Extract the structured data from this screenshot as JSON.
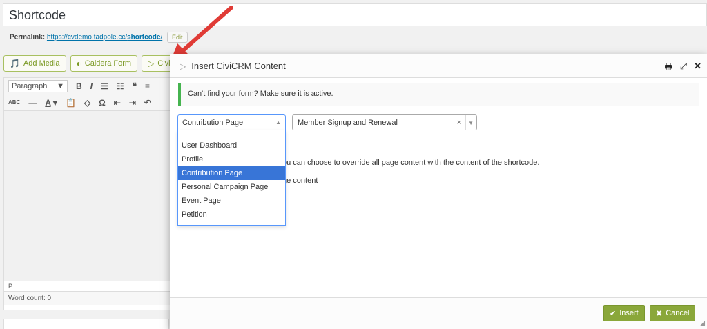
{
  "post": {
    "title": "Shortcode",
    "permalink_label": "Permalink:",
    "permalink_base": "https://cvdemo.tadpole.cc/",
    "permalink_slug": "shortcode",
    "permalink_end": "/",
    "edit_label": "Edit"
  },
  "media_buttons": [
    {
      "label": "Add Media",
      "icon": "add-media-icon"
    },
    {
      "label": "Caldera Form",
      "icon": "caldera-icon"
    },
    {
      "label": "CiviCR",
      "icon": "civicrm-icon"
    }
  ],
  "editor": {
    "format_select": "Paragraph",
    "path": "P",
    "word_count": "Word count: 0"
  },
  "modal": {
    "title": "Insert CiviCRM Content",
    "notice": "Can't find your form? Make sure it is active.",
    "component_select": {
      "value": "Contribution Page",
      "options": [
        "User Dashboard",
        "Profile",
        "Contribution Page",
        "Personal Campaign Page",
        "Event Page",
        "Petition"
      ],
      "highlighted": "Contribution Page"
    },
    "item_select": {
      "value": "Member Signup and Renewal",
      "clear": "×"
    },
    "override_text": "ou can choose to override all page content with the content of the shortcode.",
    "override_check_text": "ge content",
    "insert_label": "Insert",
    "cancel_label": "Cancel"
  },
  "colors": {
    "accent_green": "#8aa73a",
    "notice_green": "#46b450",
    "highlight_blue": "#3875d7",
    "arrow_red": "#e03b36"
  }
}
